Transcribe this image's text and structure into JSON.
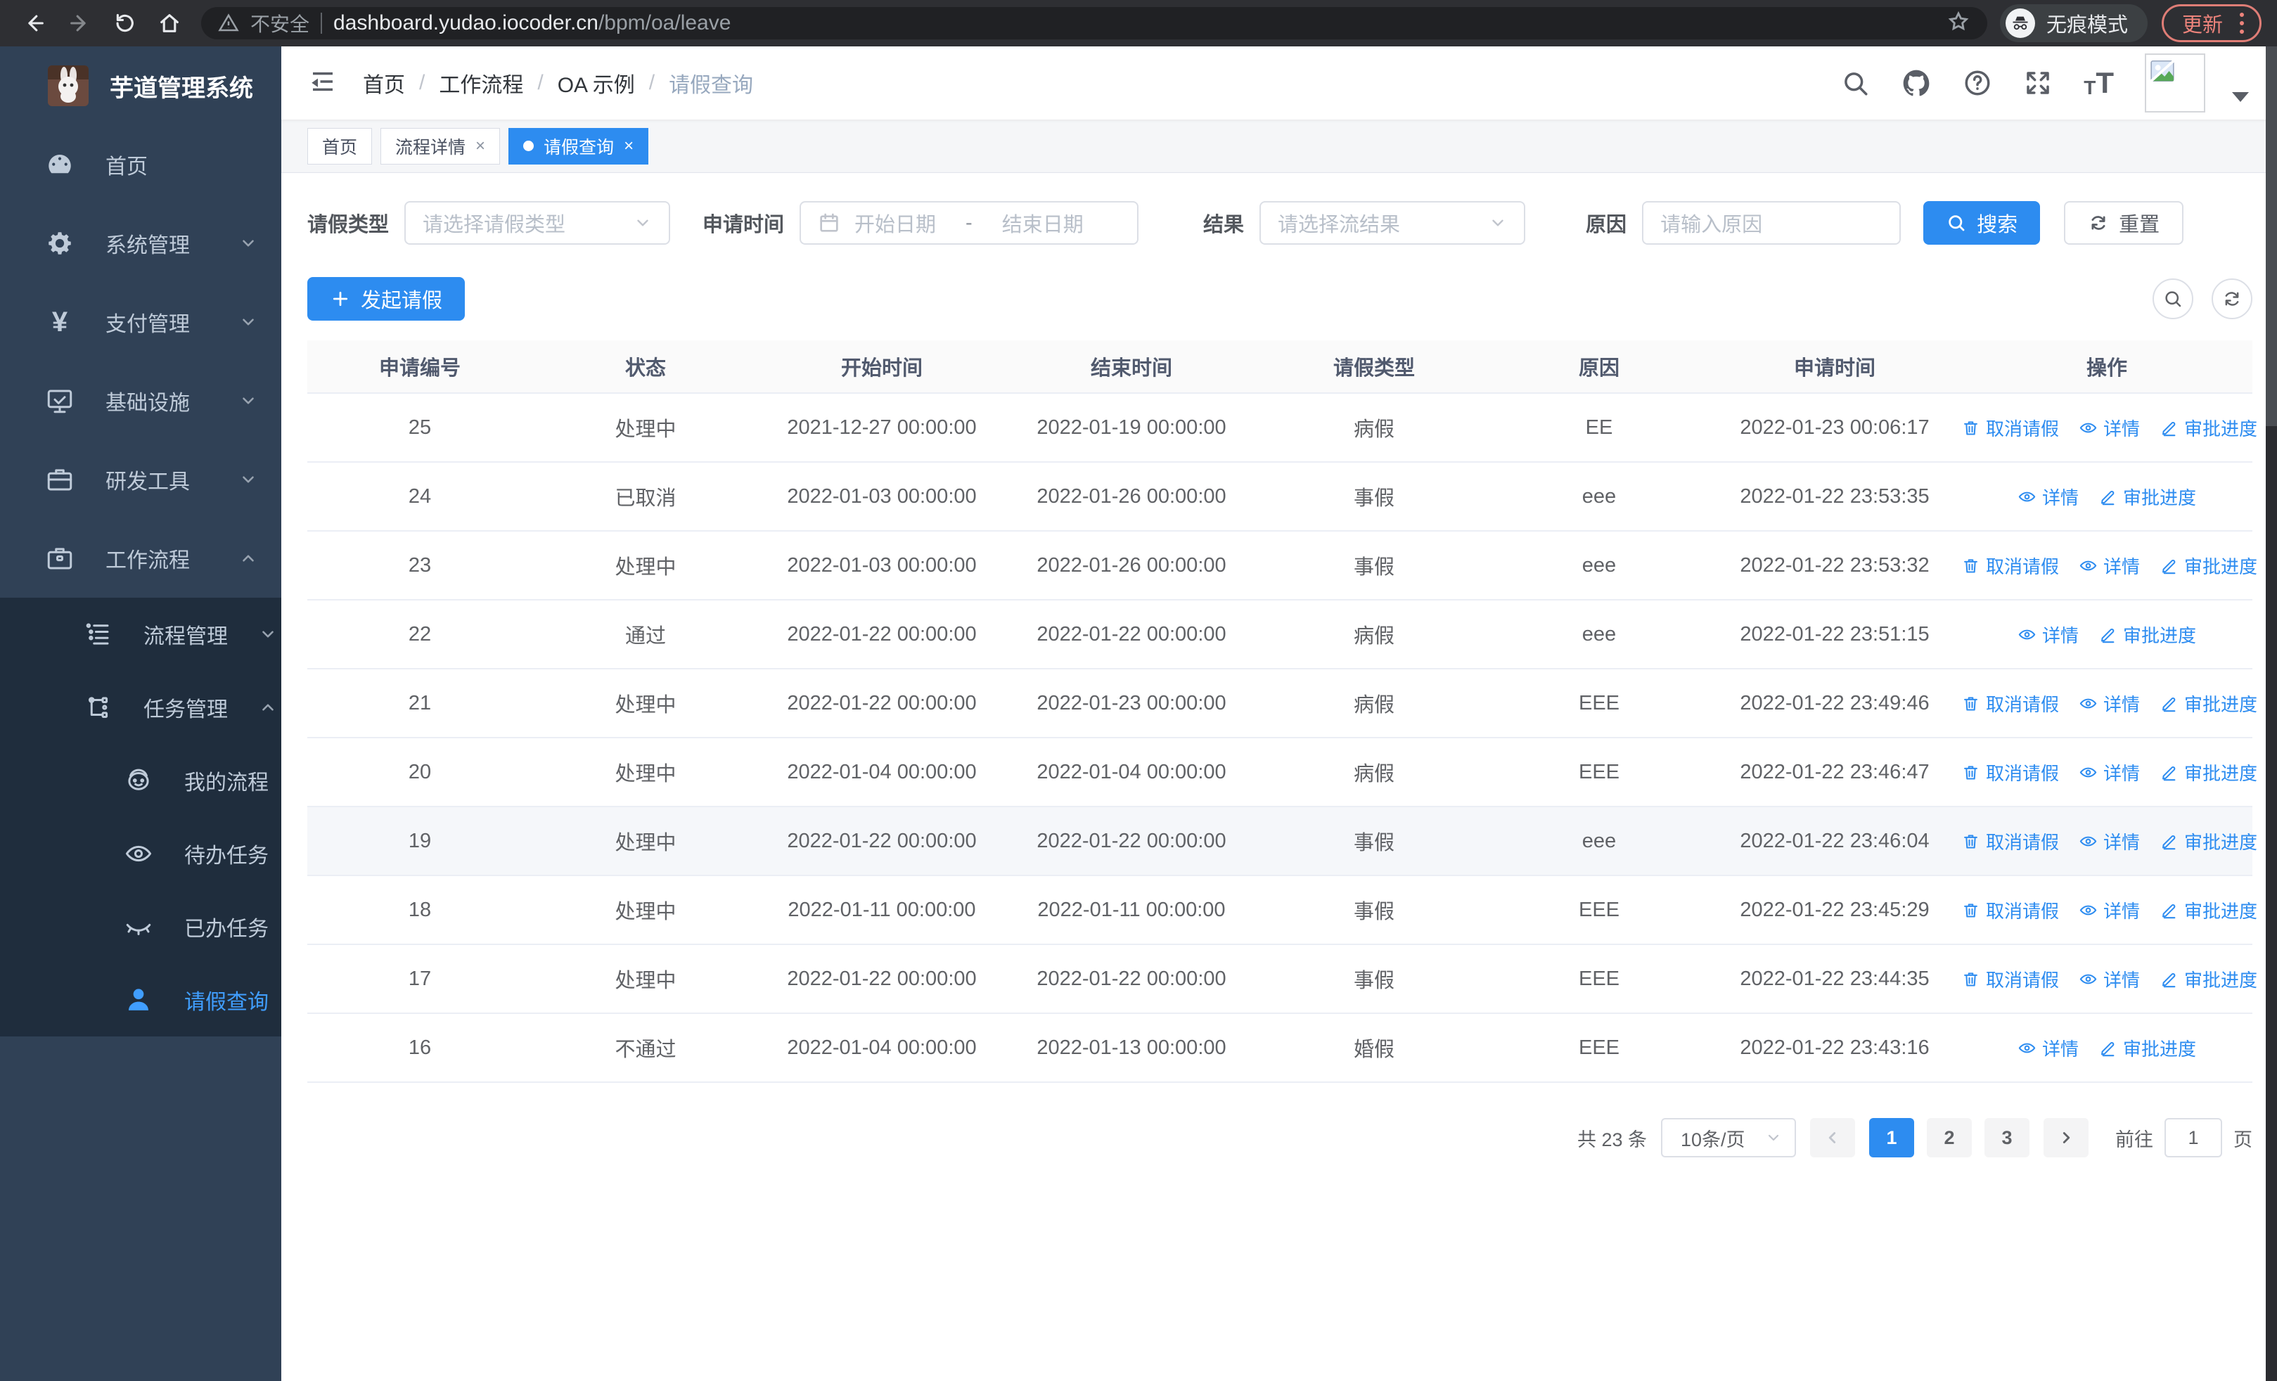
{
  "browser": {
    "security_label": "不安全",
    "url_domain": "dashboard.yudao.iocoder.cn",
    "url_path": "/bpm/oa/leave",
    "incognito_label": "无痕模式",
    "update_label": "更新"
  },
  "sidebar": {
    "title": "芋道管理系统",
    "items": [
      {
        "label": "首页",
        "icon": "dashboard-icon"
      },
      {
        "label": "系统管理",
        "icon": "gear-icon"
      },
      {
        "label": "支付管理",
        "icon": "yen-icon"
      },
      {
        "label": "基础设施",
        "icon": "monitor-icon"
      },
      {
        "label": "研发工具",
        "icon": "briefcase-icon"
      },
      {
        "label": "工作流程",
        "icon": "toolbox-icon"
      }
    ],
    "submenu": [
      {
        "label": "流程管理",
        "icon": "list-tree-icon"
      },
      {
        "label": "任务管理",
        "icon": "flow-icon"
      }
    ],
    "task_items": [
      {
        "label": "我的流程",
        "icon": "robot-icon"
      },
      {
        "label": "待办任务",
        "icon": "eye-icon"
      },
      {
        "label": "已办任务",
        "icon": "eye-closed-icon"
      },
      {
        "label": "请假查询",
        "icon": "user-icon"
      }
    ]
  },
  "header": {
    "breadcrumb": [
      "首页",
      "工作流程",
      "OA 示例",
      "请假查询"
    ]
  },
  "tabs": [
    {
      "label": "首页",
      "closable": false,
      "active": false
    },
    {
      "label": "流程详情",
      "closable": true,
      "active": false
    },
    {
      "label": "请假查询",
      "closable": true,
      "active": true
    }
  ],
  "filters": {
    "leave_type_label": "请假类型",
    "leave_type_placeholder": "请选择请假类型",
    "apply_time_label": "申请时间",
    "start_date_placeholder": "开始日期",
    "date_separator": "-",
    "end_date_placeholder": "结束日期",
    "result_label": "结果",
    "result_placeholder": "请选择流结果",
    "reason_label": "原因",
    "reason_placeholder": "请输入原因",
    "search_label": "搜索",
    "reset_label": "重置"
  },
  "toolbar": {
    "create_label": "发起请假"
  },
  "table": {
    "columns": [
      "申请编号",
      "状态",
      "开始时间",
      "结束时间",
      "请假类型",
      "原因",
      "申请时间",
      "操作"
    ],
    "op_labels": {
      "cancel": "取消请假",
      "detail": "详情",
      "progress": "审批进度"
    },
    "rows": [
      {
        "id": "25",
        "status": "处理中",
        "start": "2021-12-27 00:00:00",
        "end": "2022-01-19 00:00:00",
        "type": "病假",
        "reason": "EE",
        "apply_time": "2022-01-23 00:06:17",
        "can_cancel": true,
        "highlighted": false
      },
      {
        "id": "24",
        "status": "已取消",
        "start": "2022-01-03 00:00:00",
        "end": "2022-01-26 00:00:00",
        "type": "事假",
        "reason": "eee",
        "apply_time": "2022-01-22 23:53:35",
        "can_cancel": false,
        "highlighted": false
      },
      {
        "id": "23",
        "status": "处理中",
        "start": "2022-01-03 00:00:00",
        "end": "2022-01-26 00:00:00",
        "type": "事假",
        "reason": "eee",
        "apply_time": "2022-01-22 23:53:32",
        "can_cancel": true,
        "highlighted": false
      },
      {
        "id": "22",
        "status": "通过",
        "start": "2022-01-22 00:00:00",
        "end": "2022-01-22 00:00:00",
        "type": "病假",
        "reason": "eee",
        "apply_time": "2022-01-22 23:51:15",
        "can_cancel": false,
        "highlighted": false
      },
      {
        "id": "21",
        "status": "处理中",
        "start": "2022-01-22 00:00:00",
        "end": "2022-01-23 00:00:00",
        "type": "病假",
        "reason": "EEE",
        "apply_time": "2022-01-22 23:49:46",
        "can_cancel": true,
        "highlighted": false
      },
      {
        "id": "20",
        "status": "处理中",
        "start": "2022-01-04 00:00:00",
        "end": "2022-01-04 00:00:00",
        "type": "病假",
        "reason": "EEE",
        "apply_time": "2022-01-22 23:46:47",
        "can_cancel": true,
        "highlighted": false
      },
      {
        "id": "19",
        "status": "处理中",
        "start": "2022-01-22 00:00:00",
        "end": "2022-01-22 00:00:00",
        "type": "事假",
        "reason": "eee",
        "apply_time": "2022-01-22 23:46:04",
        "can_cancel": true,
        "highlighted": true
      },
      {
        "id": "18",
        "status": "处理中",
        "start": "2022-01-11 00:00:00",
        "end": "2022-01-11 00:00:00",
        "type": "事假",
        "reason": "EEE",
        "apply_time": "2022-01-22 23:45:29",
        "can_cancel": true,
        "highlighted": false
      },
      {
        "id": "17",
        "status": "处理中",
        "start": "2022-01-22 00:00:00",
        "end": "2022-01-22 00:00:00",
        "type": "事假",
        "reason": "EEE",
        "apply_time": "2022-01-22 23:44:35",
        "can_cancel": true,
        "highlighted": false
      },
      {
        "id": "16",
        "status": "不通过",
        "start": "2022-01-04 00:00:00",
        "end": "2022-01-13 00:00:00",
        "type": "婚假",
        "reason": "EEE",
        "apply_time": "2022-01-22 23:43:16",
        "can_cancel": false,
        "highlighted": false
      }
    ]
  },
  "pagination": {
    "total_label": "共 23 条",
    "page_size": "10条/页",
    "pages": [
      "1",
      "2",
      "3"
    ],
    "active_page": "1",
    "goto_label": "前往",
    "goto_value": "1",
    "goto_suffix": "页"
  },
  "colors": {
    "primary": "#2d8cf0",
    "active_link": "#409eff",
    "sidebar_bg": "#304156",
    "submenu_bg": "#1f2d3d"
  }
}
